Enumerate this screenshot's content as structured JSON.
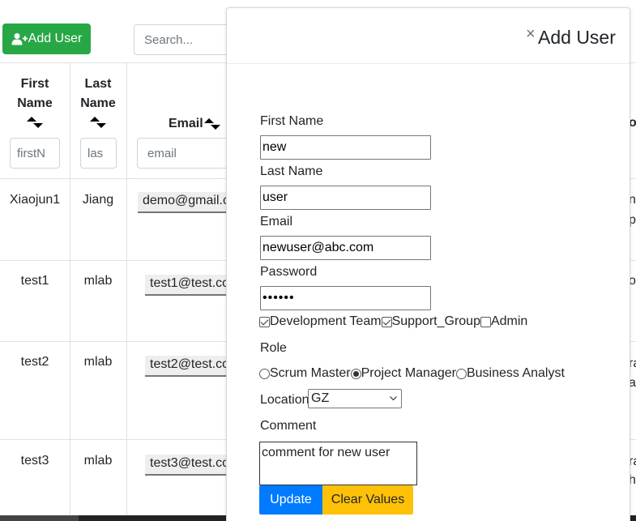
{
  "toolbar": {
    "add_user_label": "Add User",
    "search_placeholder": "Search..."
  },
  "table": {
    "headers": {
      "first_name": [
        "First",
        "Name"
      ],
      "last_name": [
        "Last",
        "Name"
      ],
      "email": "Email",
      "partial": "or"
    },
    "filters": {
      "first_name_placeholder": "firstN",
      "last_name_placeholder": "las",
      "email_placeholder": "email"
    },
    "rows": [
      {
        "first": "Xiaojun1",
        "last": "Jiang",
        "email": "demo@gmail.c",
        "right": [
          "n",
          "p"
        ]
      },
      {
        "first": "test1",
        "last": "mlab",
        "email": "test1@test.co",
        "right": [
          "o"
        ]
      },
      {
        "first": "test2",
        "last": "mlab",
        "email": "test2@test.co",
        "right": [
          "ra",
          "a"
        ]
      },
      {
        "first": "test3",
        "last": "mlab",
        "email": "test3@test.co",
        "right": [
          "ra",
          "h"
        ]
      }
    ]
  },
  "modal": {
    "close_symbol": "×",
    "title": "Add User",
    "first_name_label": "First Name",
    "first_name_value": "new",
    "last_name_label": "Last Name",
    "last_name_value": "user",
    "email_label": "Email",
    "email_value": "newuser@abc.com",
    "password_label": "Password",
    "password_value": "••••••",
    "groups": [
      {
        "label": "Development Team",
        "checked": true
      },
      {
        "label": "Support_Group",
        "checked": true
      },
      {
        "label": "Admin",
        "checked": false
      }
    ],
    "role_label": "Role",
    "roles": [
      {
        "label": "Scrum Master",
        "checked": false
      },
      {
        "label": "Project Manager",
        "checked": true
      },
      {
        "label": "Business Analyst",
        "checked": false
      }
    ],
    "location_label": "Location",
    "location_value": "GZ",
    "comment_label": "Comment",
    "comment_value": "comment for new user",
    "update_label": "Update",
    "clear_label": "Clear Values"
  },
  "colors": {
    "success": "#28a745",
    "primary": "#007bff",
    "warning": "#ffc107"
  }
}
